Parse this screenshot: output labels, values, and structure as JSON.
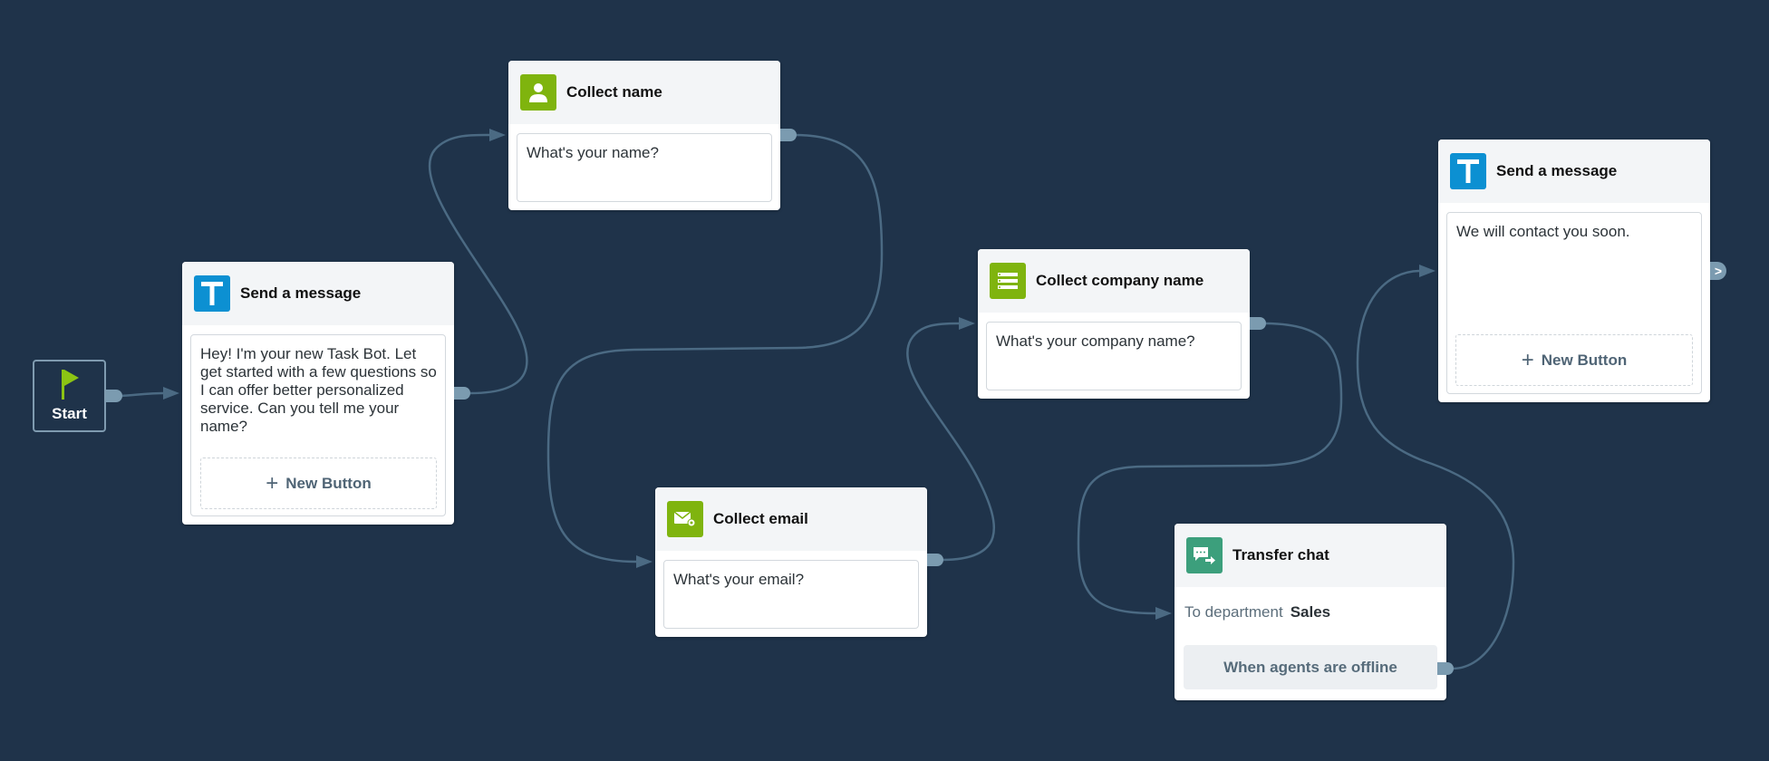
{
  "colors": {
    "background": "#1f334a",
    "connector": "#4b6a83",
    "handle": "#7b9bb0",
    "message_icon": "#0c90d2",
    "collect_icon": "#7fb40e",
    "transfer_icon": "#3c9f7c",
    "start_flag": "#8cc414"
  },
  "start": {
    "label": "Start",
    "icon": "flag-icon"
  },
  "nodes": [
    {
      "id": "send-message-1",
      "type": "send_message",
      "icon": "text-t-icon",
      "title": "Send a message",
      "message": "Hey! I'm your new Task Bot. Let get started with a few questions so I can offer better personalized service. Can you tell me your name?",
      "new_button_label": "New Button"
    },
    {
      "id": "collect-name",
      "type": "collect",
      "icon": "person-icon",
      "title": "Collect name",
      "message": "What's your name?"
    },
    {
      "id": "collect-email",
      "type": "collect",
      "icon": "email-icon",
      "title": "Collect email",
      "message": "What's your email?"
    },
    {
      "id": "collect-company",
      "type": "collect",
      "icon": "list-icon",
      "title": "Collect company name",
      "message": "What's your company name?"
    },
    {
      "id": "transfer-chat",
      "type": "transfer",
      "icon": "chat-transfer-icon",
      "title": "Transfer chat",
      "department_label": "To department",
      "department_value": "Sales",
      "offline_label": "When agents are offline"
    },
    {
      "id": "send-message-2",
      "type": "send_message",
      "icon": "text-t-icon",
      "title": "Send a message",
      "message": "We will contact you soon.",
      "new_button_label": "New Button"
    }
  ],
  "connections": [
    {
      "from": "start",
      "to": "send-message-1"
    },
    {
      "from": "send-message-1",
      "to": "collect-name"
    },
    {
      "from": "collect-name",
      "to": "collect-email"
    },
    {
      "from": "collect-email",
      "to": "collect-company"
    },
    {
      "from": "collect-company",
      "to": "transfer-chat"
    },
    {
      "from": "transfer-chat.offline",
      "to": "send-message-2"
    }
  ],
  "output_chevron": ">"
}
